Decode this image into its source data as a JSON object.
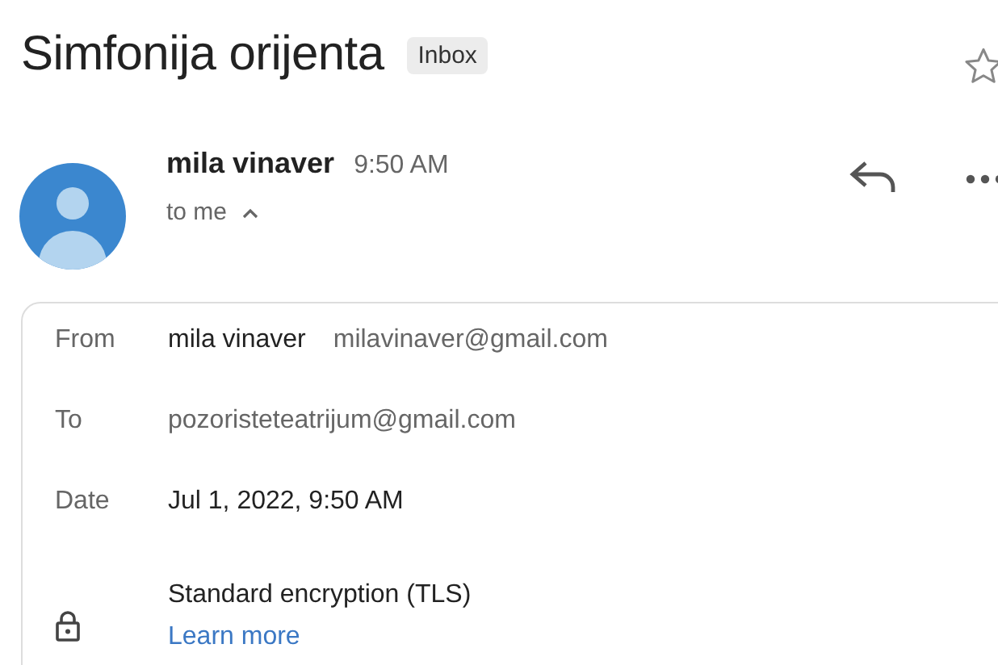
{
  "subject": "Simfonija orijenta",
  "label": "Inbox",
  "starred": false,
  "sender": {
    "name": "mila vinaver",
    "time": "9:50 AM",
    "recipient": "to me",
    "details_expanded": true
  },
  "details": [
    {
      "kind": "from",
      "label": "From",
      "name": "mila vinaver",
      "value": "milavinaver@gmail.com"
    },
    {
      "kind": "plain",
      "label": "To",
      "value": "pozoristeteatrijum@gmail.com"
    },
    {
      "kind": "strong",
      "label": "Date",
      "value": "Jul 1, 2022, 9:50 AM"
    },
    {
      "kind": "security",
      "value": "Standard encryption (TLS)",
      "link": "Learn more"
    }
  ]
}
